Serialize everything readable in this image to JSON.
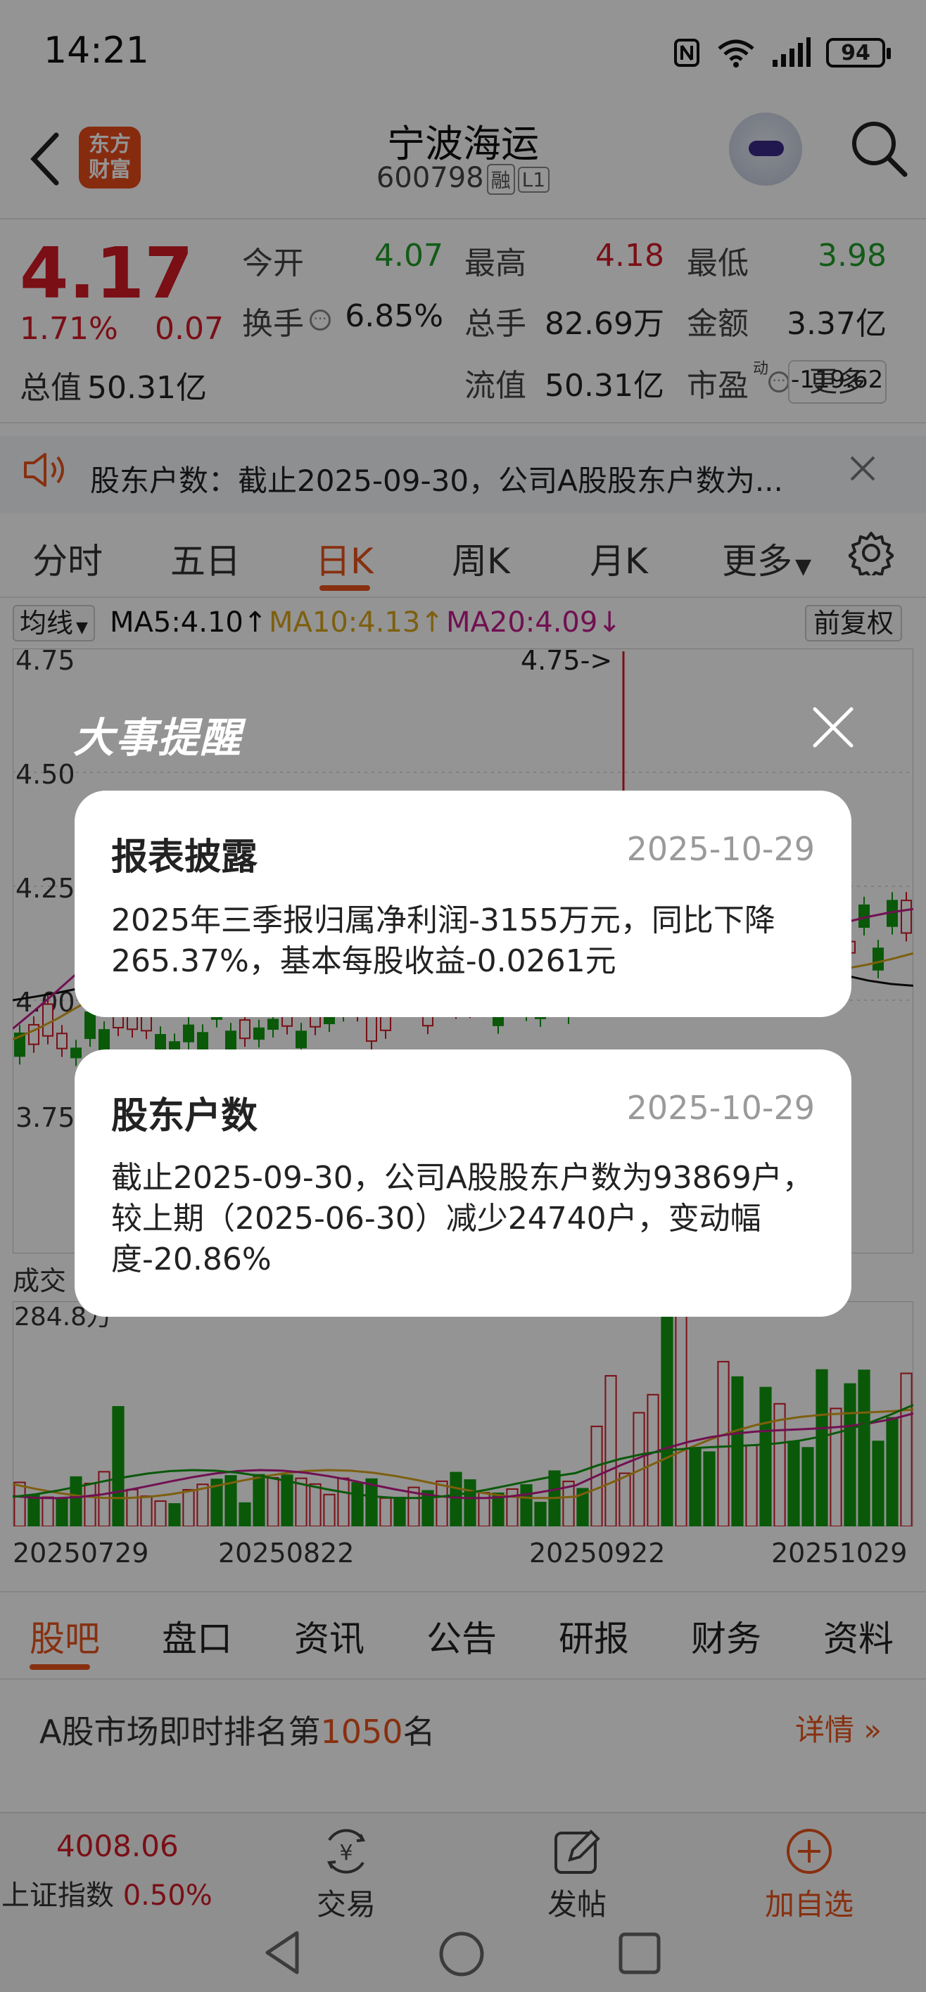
{
  "status_bar": {
    "time": "14:21",
    "battery": "94"
  },
  "header": {
    "stock_name": "宁波海运",
    "stock_code": "600798",
    "tag_margin": "融",
    "tag_level": "L1",
    "logo_text": "东方财富"
  },
  "quote": {
    "price": "4.17",
    "change_pct": "1.71%",
    "change": "0.07",
    "rows": [
      [
        {
          "label": "今开",
          "value": "4.07",
          "color": "#1f9d2a"
        },
        {
          "label": "最高",
          "value": "4.18",
          "color": "#d21a26"
        },
        {
          "label": "最低",
          "value": "3.98",
          "color": "#1f9d2a"
        }
      ],
      [
        {
          "label": "换手",
          "value": "6.85%",
          "color": "#222222"
        },
        {
          "label": "总手",
          "value": "82.69万",
          "color": "#222222"
        },
        {
          "label": "金额",
          "value": "3.37亿",
          "color": "#222222"
        }
      ],
      [
        {
          "label": "总值",
          "value": "50.31亿",
          "color": "#222222"
        },
        {
          "label": "流值",
          "value": "50.31亿",
          "color": "#222222"
        },
        {
          "label": "市盈",
          "value": "-119.62",
          "color": "#222222"
        }
      ]
    ],
    "pe_sup": "动",
    "more": "更多"
  },
  "notice": {
    "text": "股东户数：截止2025-09-30，公司A股股东户数为..."
  },
  "ktabs": [
    "分时",
    "五日",
    "日K",
    "周K",
    "月K",
    "更多"
  ],
  "ma": {
    "selector": "均线",
    "ma5": "MA5:4.10",
    "ma10": "MA10:4.13",
    "ma20": "MA20:4.09",
    "adjust": "前复权",
    "ma5_color": "#111111",
    "ma10_color": "#d8a41a",
    "ma20_color": "#c21d8c"
  },
  "chart": {
    "y_labels": [
      "4.75",
      "4.50",
      "4.25",
      "4.00",
      "3.75"
    ],
    "max_label": "4.75->",
    "vol_label": "成交",
    "vol_max": "284.8万",
    "dates": [
      "20250729",
      "20250822",
      "20250922",
      "20251029"
    ]
  },
  "modal": {
    "title": "大事提醒",
    "cards": [
      {
        "title": "报表披露",
        "date": "2025-10-29",
        "body": "2025年三季报归属净利润-3155万元，同比下降265.37%，基本每股收益-0.0261元"
      },
      {
        "title": "股东户数",
        "date": "2025-10-29",
        "body": "截止2025-09-30，公司A股股东户数为93869户，较上期（2025-06-30）减少24740户，变动幅度-20.86%"
      }
    ]
  },
  "btabs": [
    "股吧",
    "盘口",
    "资讯",
    "公告",
    "研报",
    "财务",
    "资料"
  ],
  "rank": {
    "prefix": "A股市场即时排名第",
    "number": "1050",
    "suffix": "名",
    "detail": "详情 »"
  },
  "nav": {
    "index_value": "4008.06",
    "index_name": "上证指数",
    "index_pct": "0.50%",
    "trade": "交易",
    "post": "发帖",
    "add": "加自选"
  }
}
